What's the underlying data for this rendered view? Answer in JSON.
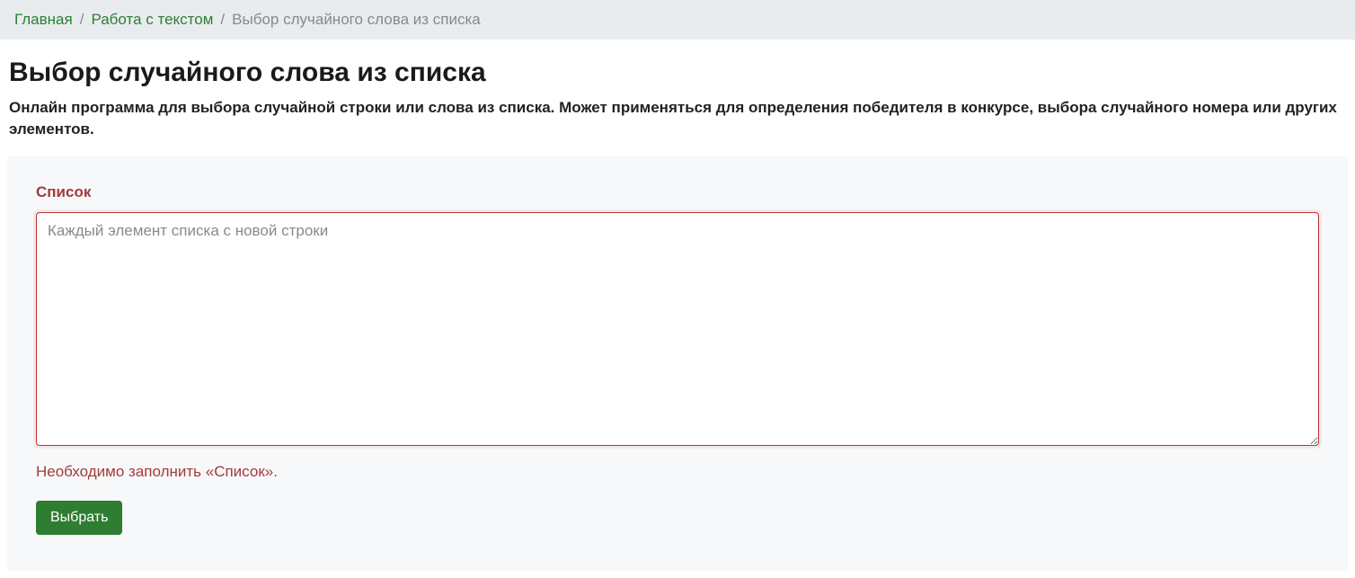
{
  "breadcrumb": {
    "home": "Главная",
    "section": "Работа с текстом",
    "current": "Выбор случайного слова из списка"
  },
  "page": {
    "title": "Выбор случайного слова из списка",
    "description": "Онлайн программа для выбора случайной строки или слова из списка. Может применяться для определения победителя в конкурсе, выбора случайного номера или других элементов."
  },
  "form": {
    "label": "Список",
    "placeholder": "Каждый элемент списка с новой строки",
    "error": "Необходимо заполнить «Список».",
    "submit": "Выбрать"
  }
}
